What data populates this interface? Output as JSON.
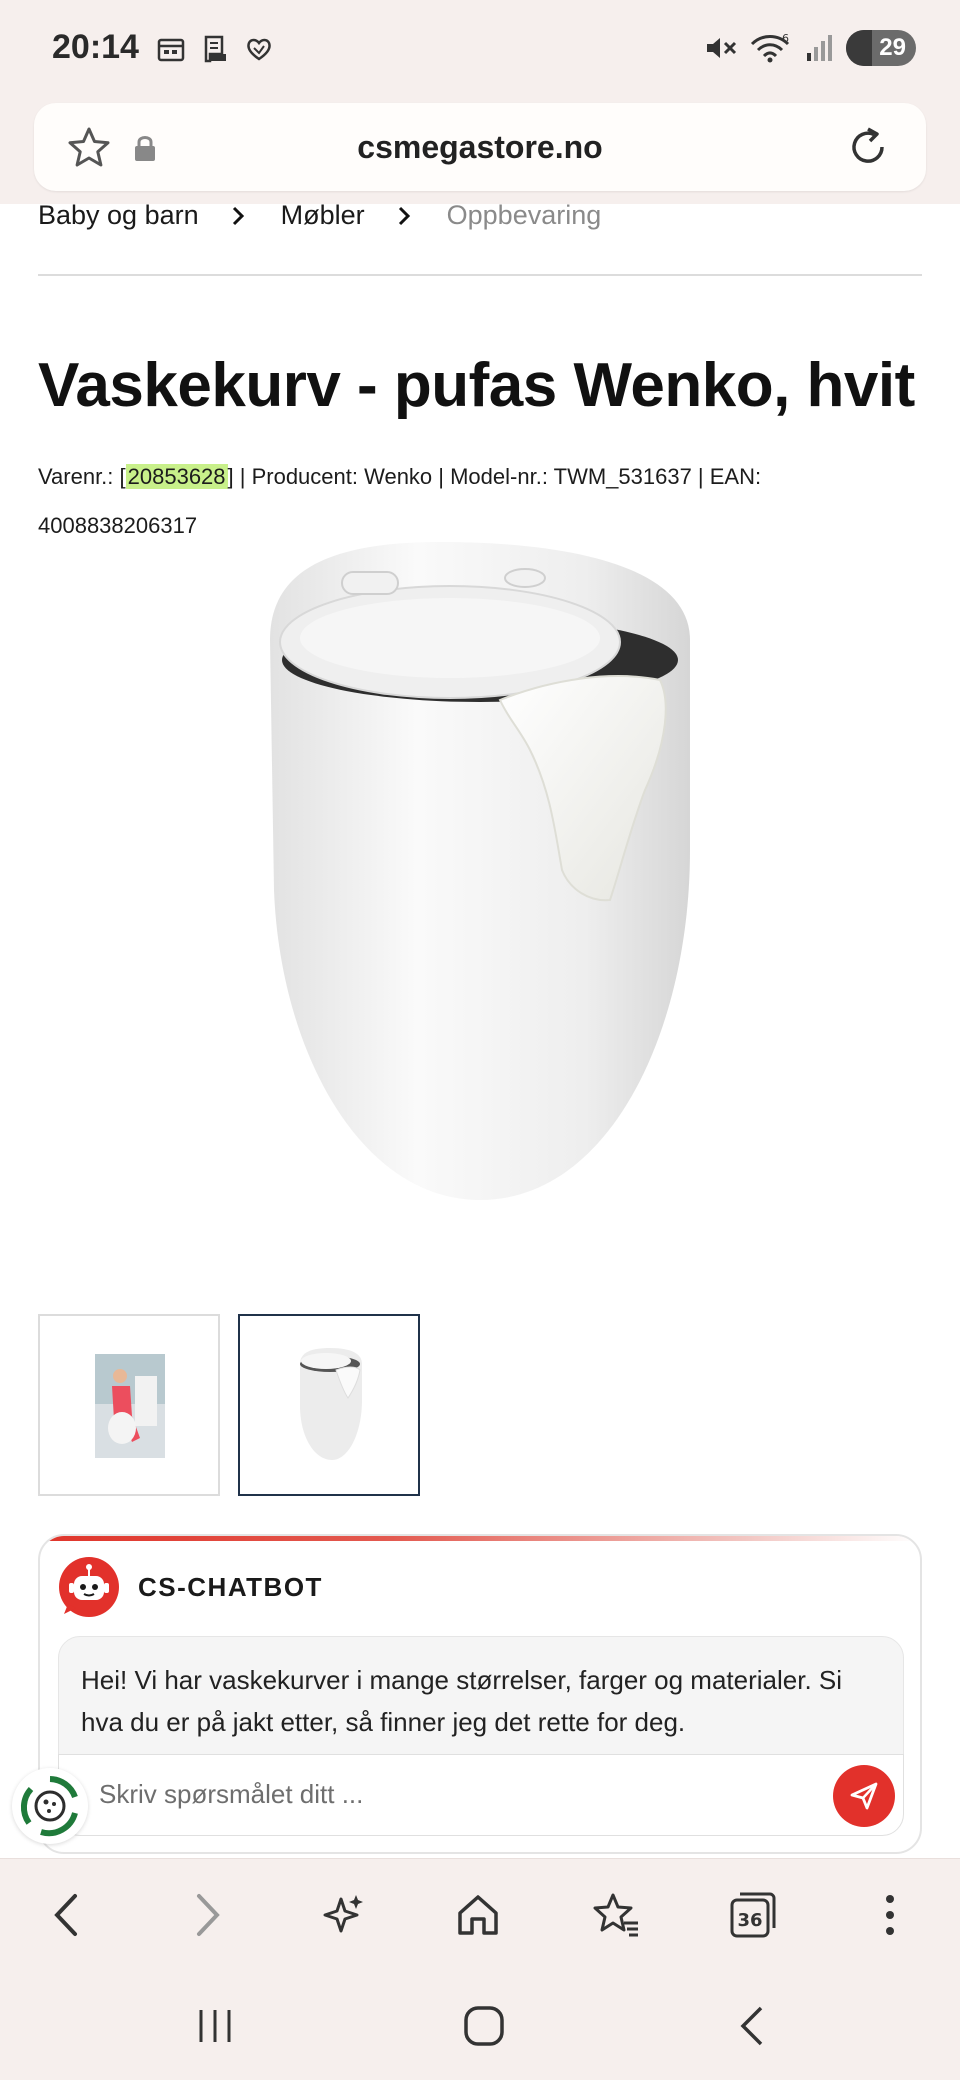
{
  "status_bar": {
    "time": "20:14",
    "battery": "29"
  },
  "browser": {
    "url": "csmegastore.no",
    "tab_count": "36"
  },
  "breadcrumb": [
    "Baby og barn",
    "Møbler",
    "Oppbevaring"
  ],
  "product": {
    "title": "Vaskekurv - pufas Wenko, hvit",
    "meta_prefix": "Varenr.: [",
    "item_number": "20853628",
    "meta_suffix": "] | Producent: Wenko | Model-nr.: TWM_531637 | EAN: 4008838206317"
  },
  "chatbot": {
    "name": "CS-CHATBOT",
    "message": "Hei! Vi har vaskekurver i mange størrelser, farger og materialer. Si hva du er på jakt etter, så finner jeg det rette for deg.",
    "input_placeholder": "Skriv spørsmålet ditt ..."
  },
  "colors": {
    "accent": "#e2312b",
    "chrome_bg": "#f6efed",
    "highlight": "#c8f08a",
    "active_thumb_border": "#20324a"
  },
  "icons": {
    "status_left": [
      "calendar-icon",
      "receipt-icon",
      "heart-hand-icon"
    ],
    "status_right": [
      "mute-icon",
      "wifi-icon",
      "signal-icon",
      "battery-icon"
    ],
    "bottom_nav": [
      "back-icon",
      "forward-icon",
      "ai-sparkle-icon",
      "home-icon",
      "bookmarks-icon",
      "tabs-icon",
      "more-icon"
    ],
    "system_nav": [
      "recents-icon",
      "home-circle-icon",
      "system-back-icon"
    ]
  }
}
